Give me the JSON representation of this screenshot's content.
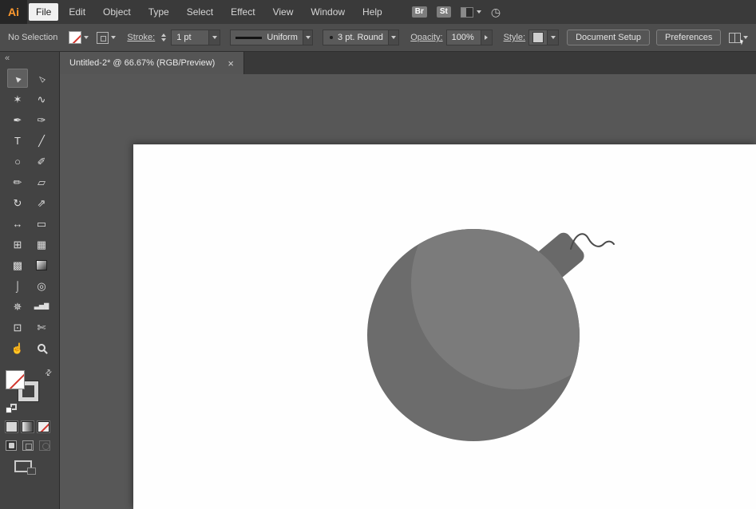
{
  "colors": {
    "accent": "#ff9a2e",
    "none_red": "#d2372f",
    "bomb_body": "#6c6c6c",
    "bomb_highlight": "#7b7b7b",
    "bomb_cap": "#696969",
    "fuse": "#4a4a4a"
  },
  "menubar": {
    "logo": "Ai",
    "items": [
      "File",
      "Edit",
      "Object",
      "Type",
      "Select",
      "Effect",
      "View",
      "Window",
      "Help"
    ],
    "active_item": "File",
    "bridge_label": "Br",
    "stock_label": "St"
  },
  "controlbar": {
    "selection_status": "No Selection",
    "stroke_label": "Stroke:",
    "stroke_value": "1 pt",
    "variable_width_profile": "Uniform",
    "brush_definition": "3 pt. Round",
    "opacity_label": "Opacity:",
    "opacity_value": "100%",
    "style_label": "Style:",
    "document_setup_label": "Document Setup",
    "preferences_label": "Preferences"
  },
  "tabbar": {
    "collapse_icon": "«",
    "document_title": "Untitled-2* @ 66.67% (RGB/Preview)",
    "close_icon": "×"
  },
  "tools": [
    {
      "name": "selection-tool",
      "glyph": "►"
    },
    {
      "name": "direct-selection-tool",
      "glyph": "▻"
    },
    {
      "name": "magic-wand-tool",
      "glyph": "✶"
    },
    {
      "name": "lasso-tool",
      "glyph": "∿"
    },
    {
      "name": "pen-tool",
      "glyph": "✒"
    },
    {
      "name": "curvature-tool",
      "glyph": "✑"
    },
    {
      "name": "type-tool",
      "glyph": "T"
    },
    {
      "name": "line-segment-tool",
      "glyph": "╱"
    },
    {
      "name": "ellipse-tool",
      "glyph": "○"
    },
    {
      "name": "paintbrush-tool",
      "glyph": "✐"
    },
    {
      "name": "shaper-tool",
      "glyph": "✏"
    },
    {
      "name": "eraser-tool",
      "glyph": "▱"
    },
    {
      "name": "rotate-tool",
      "glyph": "↻"
    },
    {
      "name": "scale-tool",
      "glyph": "⇗"
    },
    {
      "name": "width-tool",
      "glyph": "↔"
    },
    {
      "name": "free-transform-tool",
      "glyph": "▭"
    },
    {
      "name": "shape-builder-tool",
      "glyph": "⊞"
    },
    {
      "name": "perspective-grid-tool",
      "glyph": "▦"
    },
    {
      "name": "mesh-tool",
      "glyph": "▩"
    },
    {
      "name": "gradient-tool",
      "glyph": ""
    },
    {
      "name": "eyedropper-tool",
      "glyph": "⌡"
    },
    {
      "name": "blend-tool",
      "glyph": "◎"
    },
    {
      "name": "symbol-sprayer-tool",
      "glyph": "✵"
    },
    {
      "name": "column-graph-tool",
      "glyph": "▃▅▇"
    },
    {
      "name": "artboard-tool",
      "glyph": "⊡"
    },
    {
      "name": "slice-tool",
      "glyph": "✄"
    },
    {
      "name": "hand-tool",
      "glyph": "☝"
    },
    {
      "name": "zoom-tool",
      "glyph": ""
    }
  ],
  "icons": {
    "swap_fill_stroke": "⇄",
    "gpu_gauge": "◷"
  }
}
